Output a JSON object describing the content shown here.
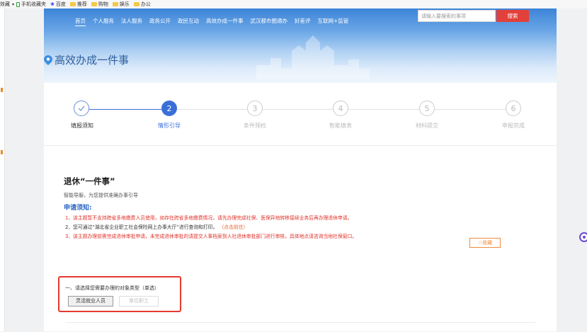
{
  "bookmarks": {
    "lead": "效藏",
    "items": [
      "手机收藏夹",
      "百度",
      "推荐",
      "购物",
      "娱乐",
      "办公"
    ]
  },
  "nav": {
    "items": [
      "首页",
      "个人服务",
      "法人服务",
      "政务公开",
      "政民互动",
      "高效办成一件事",
      "武汉都市圈通办",
      "好差评",
      "互联网+监管"
    ],
    "active_index": 0
  },
  "search": {
    "placeholder": "请输入要搜索的事项",
    "button": "搜索"
  },
  "page_title": "高效办成一件事",
  "steps": [
    {
      "marker": "",
      "label": "填报须知",
      "state": "done"
    },
    {
      "marker": "2",
      "label": "情形引导",
      "state": "active"
    },
    {
      "marker": "3",
      "label": "条件预检",
      "state": "pending"
    },
    {
      "marker": "4",
      "label": "智能填表",
      "state": "pending"
    },
    {
      "marker": "5",
      "label": "材料提交",
      "state": "pending"
    },
    {
      "marker": "6",
      "label": "申报完成",
      "state": "pending"
    }
  ],
  "section": {
    "title": "退休“一件事”",
    "guide": "智能导服，为您提供准确办事引导",
    "notice_heading": "申请须知:",
    "notes": [
      "1、该主题暂不支持跨省多地缴费人员使用，如存在跨省多地缴费情况，请先办理完成社保、医保异地转移接续业务后再办理退休申请。",
      "2、您可通过“湖北省企业职工社会保险网上办事大厅”进行查询和打印。",
      "（点击前往）",
      "3、该主题办理前需完成退休审批申请，未完成退休审批的请提交人事档案到人社退休审批部门进行审核，具体地点请咨询当地社保窗口。"
    ],
    "favorite_button": "☆收藏"
  },
  "selector": {
    "label": "一、请选择您需要办理的对象类型（单选）",
    "options": [
      "灵活就业人员",
      "单位职工"
    ],
    "selected_index": 0
  },
  "colors": {
    "primary": "#3a6fd8",
    "danger": "#e0322a",
    "accent_orange": "#f08a3a"
  }
}
